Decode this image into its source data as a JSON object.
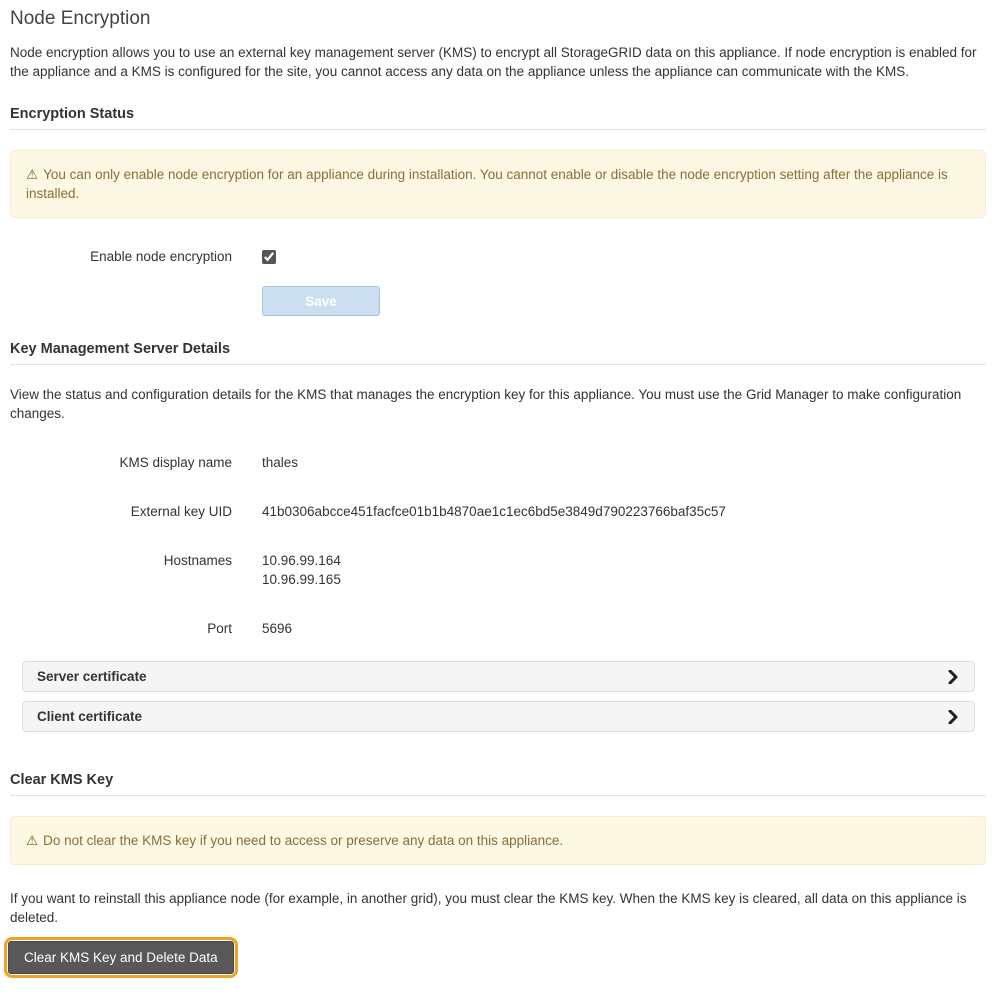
{
  "page": {
    "title": "Node Encryption",
    "intro": "Node encryption allows you to use an external key management server (KMS) to encrypt all StorageGRID data on this appliance. If node encryption is enabled for the appliance and a KMS is configured for the site, you cannot access any data on the appliance unless the appliance can communicate with the KMS."
  },
  "icons": {
    "warning": "⚠"
  },
  "encryption_status": {
    "heading": "Encryption Status",
    "warning": "You can only enable node encryption for an appliance during installation. You cannot enable or disable the node encryption setting after the appliance is installed.",
    "enable_label": "Enable node encryption",
    "enable_checked": true,
    "save_label": "Save",
    "save_disabled": true
  },
  "kms_details": {
    "heading": "Key Management Server Details",
    "description": "View the status and configuration details for the KMS that manages the encryption key for this appliance. You must use the Grid Manager to make configuration changes.",
    "fields": [
      {
        "label": "KMS display name",
        "value": "thales"
      },
      {
        "label": "External key UID",
        "value": "41b0306abcce451facfce01b1b4870ae1c1ec6bd5e3849d790223766baf35c57"
      },
      {
        "label": "Hostnames",
        "values": [
          "10.96.99.164",
          "10.96.99.165"
        ]
      },
      {
        "label": "Port",
        "value": "5696"
      }
    ],
    "accordions": [
      {
        "label": "Server certificate"
      },
      {
        "label": "Client certificate"
      }
    ]
  },
  "clear_kms": {
    "heading": "Clear KMS Key",
    "warning": "Do not clear the KMS key if you need to access or preserve any data on this appliance.",
    "description": "If you want to reinstall this appliance node (for example, in another grid), you must clear the KMS key. When the KMS key is cleared, all data on this appliance is deleted.",
    "button_label": "Clear KMS Key and Delete Data"
  },
  "colors": {
    "warning_bg": "#fcf8e3",
    "warning_border": "#faebcc",
    "warning_text": "#8a6d3b",
    "save_button_bg": "#cbdff0",
    "save_button_border": "#a5c6e2",
    "highlight_ring": "#f0a31f",
    "danger_button_bg": "#58585a"
  }
}
